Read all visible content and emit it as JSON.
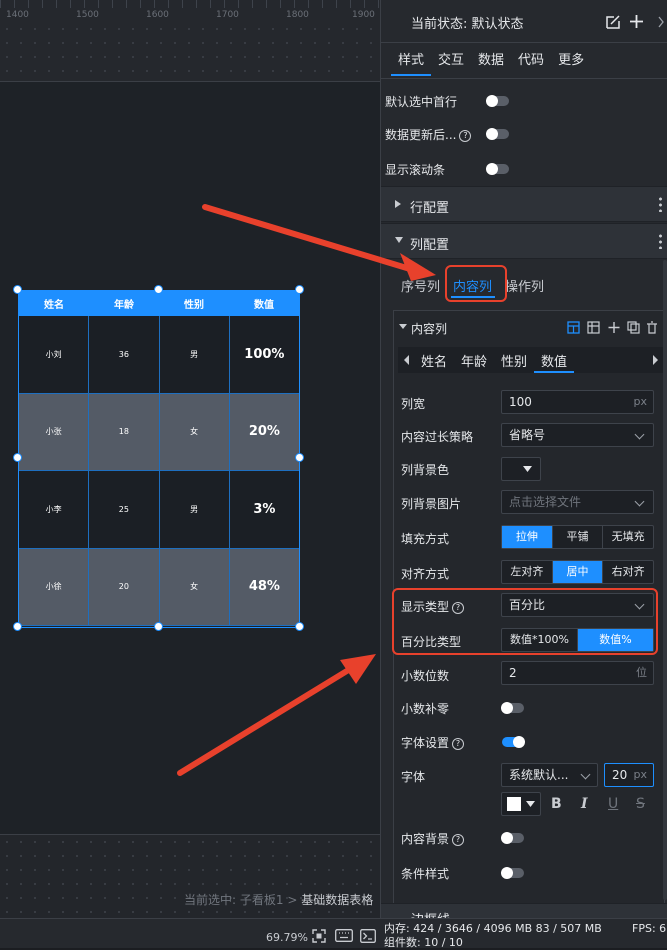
{
  "ruler": {
    "ticks": [
      "1400",
      "1500",
      "1600",
      "1700",
      "1800",
      "1900"
    ]
  },
  "breadcrumb": {
    "prefix": "当前选中: ",
    "board": "子看板1",
    "sep": " > ",
    "current": "基础数据表格"
  },
  "table": {
    "headers": [
      "姓名",
      "年龄",
      "性别",
      "数值"
    ],
    "rows": [
      [
        "小刘",
        "36",
        "男",
        "100%"
      ],
      [
        "小张",
        "18",
        "女",
        "20%"
      ],
      [
        "小李",
        "25",
        "男",
        "3%"
      ],
      [
        "小徐",
        "20",
        "女",
        "48%"
      ]
    ]
  },
  "status": {
    "zoom": "69.79%",
    "memory": "内存: 424 / 3646 / 4096 MB  83 / 507 MB",
    "components": "组件数: 10 / 10",
    "fps": "FPS: 6"
  },
  "panel": {
    "state": "当前状态: 默认状态",
    "tabs": [
      "样式",
      "交互",
      "数据",
      "代码",
      "更多"
    ],
    "toggles": {
      "default_first": "默认选中首行",
      "after_update": "数据更新后...",
      "scrollbar": "显示滚动条"
    },
    "sections": {
      "row_config": "行配置",
      "col_config": "列配置",
      "border": "边框线"
    },
    "col_tabs": [
      "序号列",
      "内容列",
      "操作列"
    ],
    "content_col": {
      "title": "内容列",
      "cols": [
        "姓名",
        "年龄",
        "性别",
        "数值"
      ]
    },
    "fields": {
      "width_label": "列宽",
      "width_value": "100",
      "width_unit": "px",
      "overflow_label": "内容过长策略",
      "overflow_value": "省略号",
      "bg_color_label": "列背景色",
      "bg_image_label": "列背景图片",
      "bg_image_placeholder": "点击选择文件",
      "fill_label": "填充方式",
      "fill_options": [
        "拉伸",
        "平铺",
        "无填充"
      ],
      "align_label": "对齐方式",
      "align_options": [
        "左对齐",
        "居中",
        "右对齐"
      ],
      "display_type_label": "显示类型",
      "display_type_value": "百分比",
      "percent_type_label": "百分比类型",
      "percent_options": [
        "数值*100%",
        "数值%"
      ],
      "decimals_label": "小数位数",
      "decimals_value": "2",
      "decimals_unit": "位",
      "zero_pad_label": "小数补零",
      "font_settings_label": "字体设置",
      "font_label": "字体",
      "font_family_value": "系统默认...",
      "font_size_value": "20",
      "font_size_unit": "px",
      "content_bg_label": "内容背景",
      "cond_style_label": "条件样式"
    }
  }
}
